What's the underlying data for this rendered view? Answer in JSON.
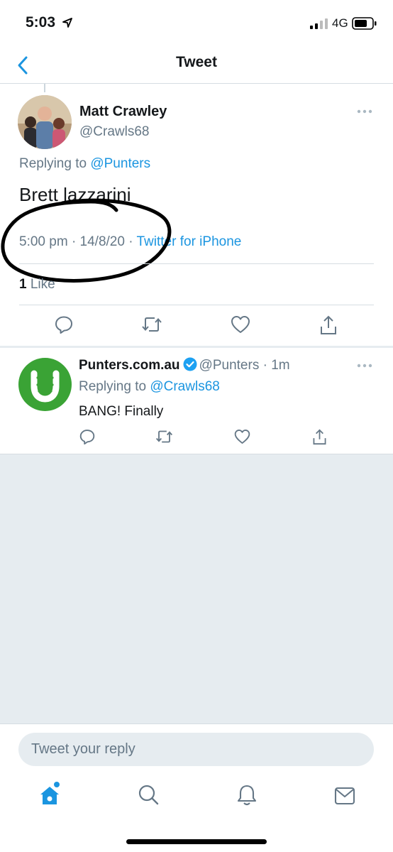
{
  "status_bar": {
    "time": "5:03",
    "network": "4G",
    "location_icon": "location-arrow-icon",
    "signal_icon": "cellular-signal-icon",
    "battery_icon": "battery-icon"
  },
  "nav": {
    "title": "Tweet",
    "back_icon": "chevron-left-icon"
  },
  "main_tweet": {
    "author_name": "Matt Crawley",
    "author_handle": "@Crawls68",
    "replying_prefix": "Replying to",
    "replying_to": "@Punters",
    "text": "Brett lazzarini",
    "time": "5:00 pm",
    "date": "14/8/20",
    "source": "Twitter for iPhone",
    "like_count": "1",
    "like_label": "Like",
    "actions": [
      "reply-icon",
      "retweet-icon",
      "like-icon",
      "share-icon"
    ]
  },
  "reply_tweet": {
    "author_name": "Punters.com.au",
    "author_handle": "@Punters",
    "time_ago": "1m",
    "replying_prefix": "Replying to",
    "replying_to": "@Crawls68",
    "text": "BANG! Finally",
    "actions": [
      "reply-icon",
      "retweet-icon",
      "like-icon",
      "share-icon"
    ]
  },
  "composer": {
    "placeholder": "Tweet your reply"
  },
  "tab_bar": {
    "tabs": [
      "home-icon",
      "search-icon",
      "notifications-icon",
      "messages-icon"
    ]
  },
  "colors": {
    "accent": "#1b95e0",
    "muted_text": "#657786",
    "background": "#e6ecf0",
    "punters_green": "#3aa335"
  }
}
